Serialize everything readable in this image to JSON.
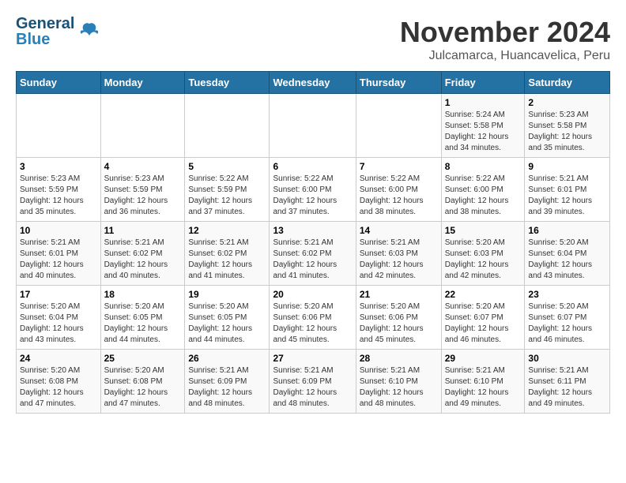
{
  "header": {
    "logo_line1": "General",
    "logo_line2": "Blue",
    "month": "November 2024",
    "location": "Julcamarca, Huancavelica, Peru"
  },
  "weekdays": [
    "Sunday",
    "Monday",
    "Tuesday",
    "Wednesday",
    "Thursday",
    "Friday",
    "Saturday"
  ],
  "weeks": [
    [
      {
        "day": "",
        "info": ""
      },
      {
        "day": "",
        "info": ""
      },
      {
        "day": "",
        "info": ""
      },
      {
        "day": "",
        "info": ""
      },
      {
        "day": "",
        "info": ""
      },
      {
        "day": "1",
        "info": "Sunrise: 5:24 AM\nSunset: 5:58 PM\nDaylight: 12 hours\nand 34 minutes."
      },
      {
        "day": "2",
        "info": "Sunrise: 5:23 AM\nSunset: 5:58 PM\nDaylight: 12 hours\nand 35 minutes."
      }
    ],
    [
      {
        "day": "3",
        "info": "Sunrise: 5:23 AM\nSunset: 5:59 PM\nDaylight: 12 hours\nand 35 minutes."
      },
      {
        "day": "4",
        "info": "Sunrise: 5:23 AM\nSunset: 5:59 PM\nDaylight: 12 hours\nand 36 minutes."
      },
      {
        "day": "5",
        "info": "Sunrise: 5:22 AM\nSunset: 5:59 PM\nDaylight: 12 hours\nand 37 minutes."
      },
      {
        "day": "6",
        "info": "Sunrise: 5:22 AM\nSunset: 6:00 PM\nDaylight: 12 hours\nand 37 minutes."
      },
      {
        "day": "7",
        "info": "Sunrise: 5:22 AM\nSunset: 6:00 PM\nDaylight: 12 hours\nand 38 minutes."
      },
      {
        "day": "8",
        "info": "Sunrise: 5:22 AM\nSunset: 6:00 PM\nDaylight: 12 hours\nand 38 minutes."
      },
      {
        "day": "9",
        "info": "Sunrise: 5:21 AM\nSunset: 6:01 PM\nDaylight: 12 hours\nand 39 minutes."
      }
    ],
    [
      {
        "day": "10",
        "info": "Sunrise: 5:21 AM\nSunset: 6:01 PM\nDaylight: 12 hours\nand 40 minutes."
      },
      {
        "day": "11",
        "info": "Sunrise: 5:21 AM\nSunset: 6:02 PM\nDaylight: 12 hours\nand 40 minutes."
      },
      {
        "day": "12",
        "info": "Sunrise: 5:21 AM\nSunset: 6:02 PM\nDaylight: 12 hours\nand 41 minutes."
      },
      {
        "day": "13",
        "info": "Sunrise: 5:21 AM\nSunset: 6:02 PM\nDaylight: 12 hours\nand 41 minutes."
      },
      {
        "day": "14",
        "info": "Sunrise: 5:21 AM\nSunset: 6:03 PM\nDaylight: 12 hours\nand 42 minutes."
      },
      {
        "day": "15",
        "info": "Sunrise: 5:20 AM\nSunset: 6:03 PM\nDaylight: 12 hours\nand 42 minutes."
      },
      {
        "day": "16",
        "info": "Sunrise: 5:20 AM\nSunset: 6:04 PM\nDaylight: 12 hours\nand 43 minutes."
      }
    ],
    [
      {
        "day": "17",
        "info": "Sunrise: 5:20 AM\nSunset: 6:04 PM\nDaylight: 12 hours\nand 43 minutes."
      },
      {
        "day": "18",
        "info": "Sunrise: 5:20 AM\nSunset: 6:05 PM\nDaylight: 12 hours\nand 44 minutes."
      },
      {
        "day": "19",
        "info": "Sunrise: 5:20 AM\nSunset: 6:05 PM\nDaylight: 12 hours\nand 44 minutes."
      },
      {
        "day": "20",
        "info": "Sunrise: 5:20 AM\nSunset: 6:06 PM\nDaylight: 12 hours\nand 45 minutes."
      },
      {
        "day": "21",
        "info": "Sunrise: 5:20 AM\nSunset: 6:06 PM\nDaylight: 12 hours\nand 45 minutes."
      },
      {
        "day": "22",
        "info": "Sunrise: 5:20 AM\nSunset: 6:07 PM\nDaylight: 12 hours\nand 46 minutes."
      },
      {
        "day": "23",
        "info": "Sunrise: 5:20 AM\nSunset: 6:07 PM\nDaylight: 12 hours\nand 46 minutes."
      }
    ],
    [
      {
        "day": "24",
        "info": "Sunrise: 5:20 AM\nSunset: 6:08 PM\nDaylight: 12 hours\nand 47 minutes."
      },
      {
        "day": "25",
        "info": "Sunrise: 5:20 AM\nSunset: 6:08 PM\nDaylight: 12 hours\nand 47 minutes."
      },
      {
        "day": "26",
        "info": "Sunrise: 5:21 AM\nSunset: 6:09 PM\nDaylight: 12 hours\nand 48 minutes."
      },
      {
        "day": "27",
        "info": "Sunrise: 5:21 AM\nSunset: 6:09 PM\nDaylight: 12 hours\nand 48 minutes."
      },
      {
        "day": "28",
        "info": "Sunrise: 5:21 AM\nSunset: 6:10 PM\nDaylight: 12 hours\nand 48 minutes."
      },
      {
        "day": "29",
        "info": "Sunrise: 5:21 AM\nSunset: 6:10 PM\nDaylight: 12 hours\nand 49 minutes."
      },
      {
        "day": "30",
        "info": "Sunrise: 5:21 AM\nSunset: 6:11 PM\nDaylight: 12 hours\nand 49 minutes."
      }
    ]
  ]
}
